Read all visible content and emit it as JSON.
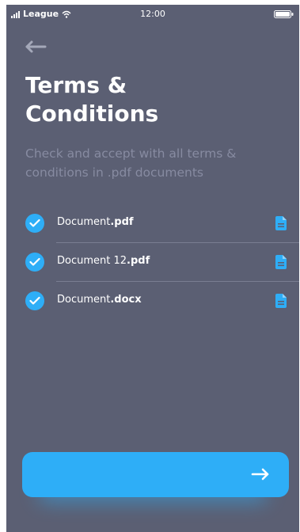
{
  "status_bar": {
    "carrier": "League",
    "time": "12:00"
  },
  "header": {
    "title": "Terms &\nConditions",
    "subtitle": "Check and accept with all terms & conditions in .pdf documents"
  },
  "documents": [
    {
      "name": "Document",
      "ext": ".pdf",
      "checked": true,
      "icon": "file-icon"
    },
    {
      "name": "Document 12",
      "ext": ".pdf",
      "checked": true,
      "icon": "file-icon"
    },
    {
      "name": "Document",
      "ext": ".docx",
      "checked": true,
      "icon": "file-icon"
    }
  ],
  "colors": {
    "background": "#5b5f73",
    "accent": "#2eaef7",
    "subtitle": "#878ba1",
    "divider": "#7a7e92"
  },
  "icons": {
    "back": "arrow-left-icon",
    "next": "arrow-right-icon",
    "check": "check-icon",
    "document": "file-icon"
  }
}
